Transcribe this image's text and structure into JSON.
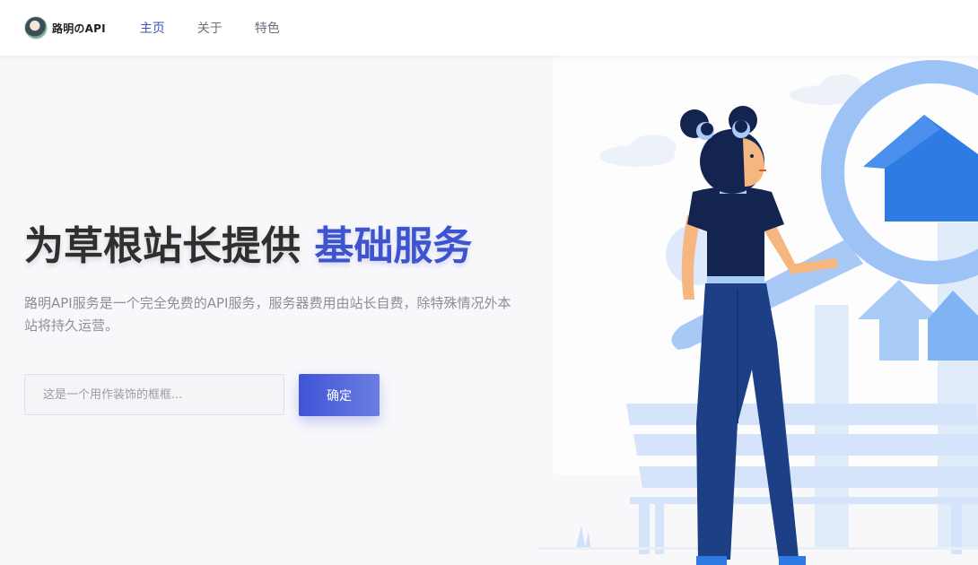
{
  "navbar": {
    "brand_name": "路明のAPI",
    "links": [
      {
        "label": "主页",
        "active": true
      },
      {
        "label": "关于",
        "active": false
      },
      {
        "label": "特色",
        "active": false
      }
    ]
  },
  "hero": {
    "title_main": "为草根站长提供 ",
    "title_accent": "基础服务",
    "description": "路明API服务是一个完全免费的API服务，服务器费用由站长自费，除特殊情况外本站将持久运营。",
    "input_placeholder": "这是一个用作装饰的框框...",
    "button_label": "确定"
  },
  "colors": {
    "accent": "#3e54cf",
    "button_gradient_start": "#3f54d6",
    "button_gradient_end": "#6b7ee2",
    "illustration_blue": "#9cc3f5",
    "figure_navy": "#13244f"
  },
  "icons": [
    "avatar-logo",
    "house-search-illustration"
  ]
}
